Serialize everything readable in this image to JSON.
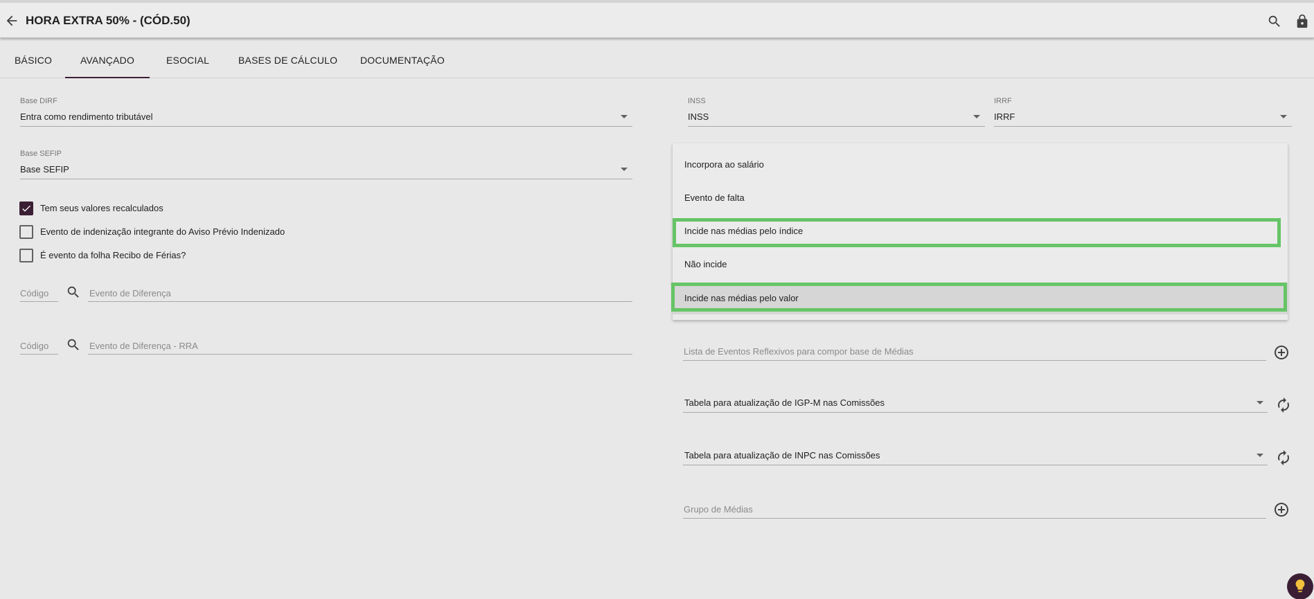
{
  "header": {
    "title": "HORA EXTRA 50% - (CÓD.50)"
  },
  "tabs": [
    {
      "label": "BÁSICO"
    },
    {
      "label": "AVANÇADO"
    },
    {
      "label": "ESOCIAL"
    },
    {
      "label": "BASES DE CÁLCULO"
    },
    {
      "label": "DOCUMENTAÇÃO"
    }
  ],
  "left": {
    "base_dirf": {
      "label": "Base DIRF",
      "value": "Entra como rendimento tributável"
    },
    "base_sefip": {
      "label": "Base SEFIP",
      "value": "Base SEFIP"
    },
    "checkboxes": [
      {
        "label": "Tem seus valores recalculados",
        "checked": true
      },
      {
        "label": "Evento de indenização integrante do Aviso Prévio Indenizado",
        "checked": false
      },
      {
        "label": "É evento da folha Recibo de Férias?",
        "checked": false
      }
    ],
    "evento_diferenca": {
      "code_placeholder": "Código",
      "placeholder": "Evento de Diferença"
    },
    "evento_diferenca_rra": {
      "code_placeholder": "Código",
      "placeholder": "Evento de Diferença - RRA"
    }
  },
  "right": {
    "inss": {
      "label": "INSS",
      "value": "INSS"
    },
    "irrf": {
      "label": "IRRF",
      "value": "IRRF"
    },
    "dropdown_options": [
      {
        "label": "Incorpora ao salário"
      },
      {
        "label": "Evento de falta"
      },
      {
        "label": "Incide nas médias pelo índice"
      },
      {
        "label": "Não incide"
      },
      {
        "label": "Incide nas médias pelo valor"
      }
    ],
    "lista_eventos": {
      "placeholder": "Lista de Eventos Reflexivos para compor base de Médias"
    },
    "tabela_igpm": {
      "value": "Tabela para atualização de IGP-M nas Comissões"
    },
    "tabela_inpc": {
      "value": "Tabela para atualização de INPC nas Comissões"
    },
    "grupo_medias": {
      "placeholder": "Grupo de Médias"
    }
  },
  "colors": {
    "accent": "#3a1f34",
    "highlight_box": "#66c466"
  }
}
